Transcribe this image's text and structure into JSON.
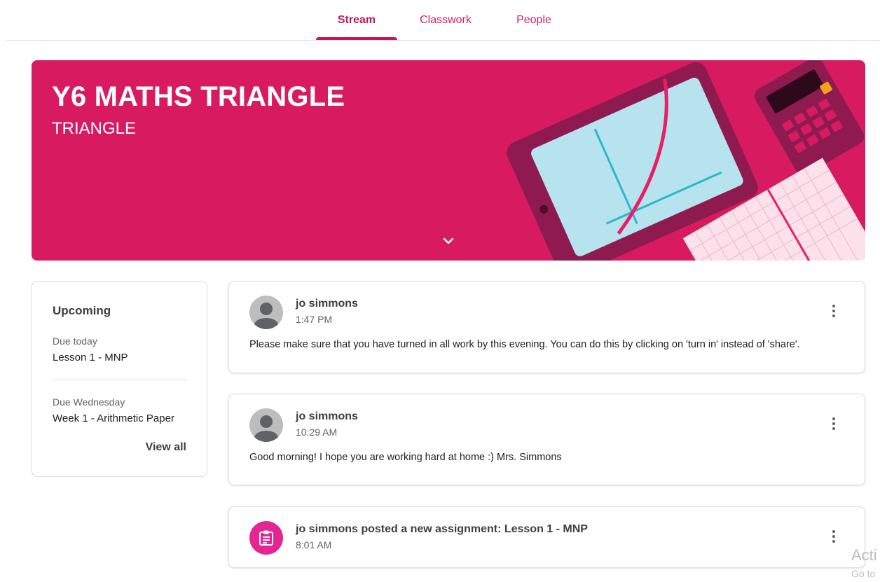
{
  "tabs": [
    {
      "label": "Stream",
      "active": true
    },
    {
      "label": "Classwork",
      "active": false
    },
    {
      "label": "People",
      "active": false
    }
  ],
  "banner": {
    "title": "Y6 MATHS TRIANGLE",
    "subtitle": "TRIANGLE",
    "color": "#d81b60",
    "expand_icon": "chevron-down-icon"
  },
  "upcoming": {
    "title": "Upcoming",
    "items": [
      {
        "due": "Due today",
        "name": "Lesson 1 - MNP"
      },
      {
        "due": "Due Wednesday",
        "name": "Week 1 - Arithmetic Paper"
      }
    ],
    "view_all": "View all"
  },
  "posts": [
    {
      "author": "jo simmons",
      "time": "1:47 PM",
      "body": "Please make sure that you have turned in all work by this evening. You can do this by clicking on 'turn in' instead of 'share'.",
      "icon": "avatar"
    },
    {
      "author": "jo simmons",
      "time": "10:29 AM",
      "body": "Good morning! I hope you are working hard at home :) Mrs. Simmons",
      "icon": "avatar"
    },
    {
      "author": "jo simmons posted a new assignment: Lesson 1 - MNP",
      "time": "8:01 AM",
      "icon": "assignment-icon"
    }
  ],
  "watermark": {
    "line1": "Acti",
    "line2": "Go to"
  },
  "colors": {
    "accent": "#c2185b",
    "assignment": "#e52592"
  }
}
